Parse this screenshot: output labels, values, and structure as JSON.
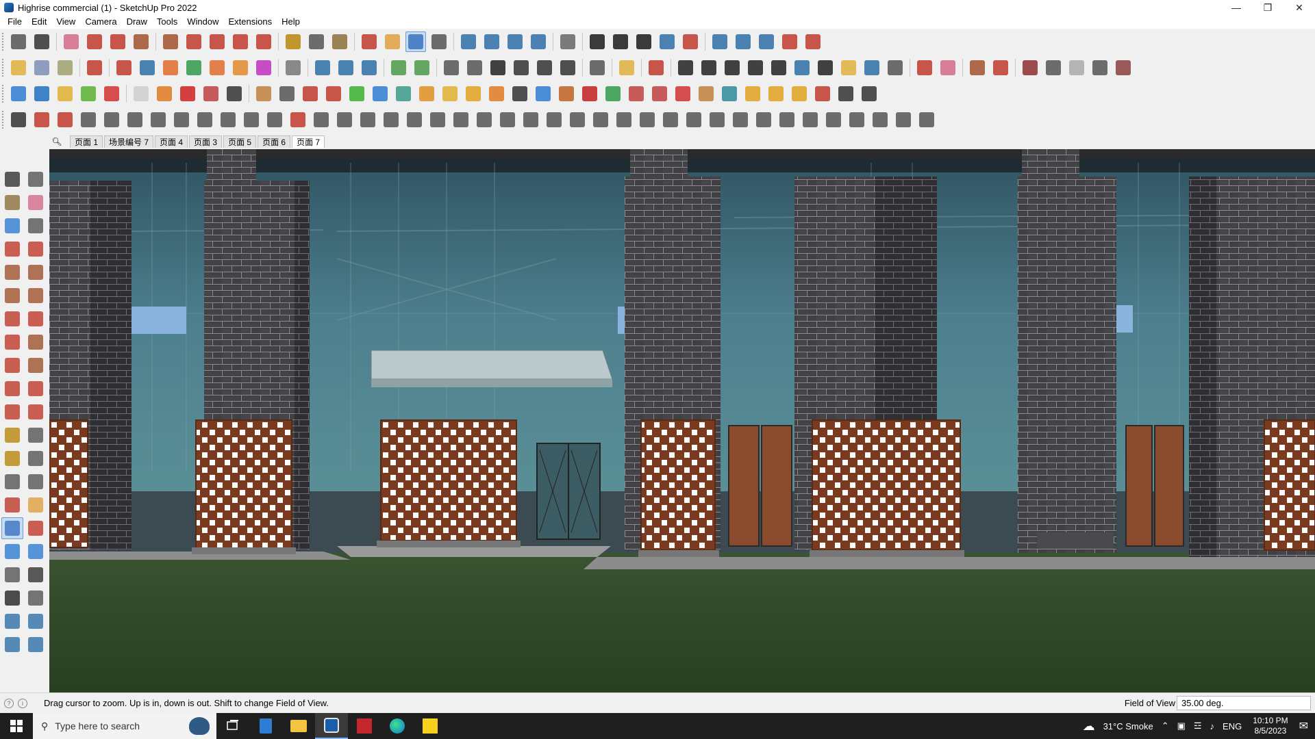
{
  "window": {
    "title": "Highrise commercial (1) - SketchUp Pro 2022",
    "minimize": "—",
    "maximize": "❐",
    "close": "✕"
  },
  "menu": [
    "File",
    "Edit",
    "View",
    "Camera",
    "Draw",
    "Tools",
    "Window",
    "Extensions",
    "Help"
  ],
  "scenes": {
    "search_icon": "search-icon",
    "tabs": [
      "页面 1",
      "场景编号 7",
      "页面 4",
      "页面 3",
      "页面 5",
      "页面 6",
      "页面 7"
    ],
    "active": "页面 7"
  },
  "status": {
    "message": "Drag cursor to zoom.  Up is in, down is out. Shift to change Field of View.",
    "vcb_label": "Field of View",
    "vcb_value": "35.00 deg."
  },
  "taskbar": {
    "search_placeholder": "Type here to search",
    "weather": "31°C  Smoke",
    "language": "ENG",
    "time": "10:10 PM",
    "date": "8/5/2023"
  },
  "colors": {
    "brick_dark": "#3d3d40",
    "brick_mortar": "#9a9aa0",
    "lattice_brown": "#7a3a1f",
    "door_brown": "#8a4a2c",
    "glass": "#46707f",
    "sky_blue": "#88b4e0",
    "ground": "#2f4626",
    "pavement": "#8c8c8c",
    "accent": "#0078d7"
  }
}
